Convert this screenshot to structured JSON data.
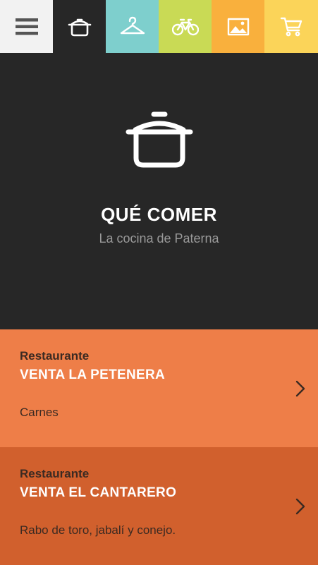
{
  "colors": {
    "menu_tab": "#f2f2f2",
    "food_tab": "#272727",
    "clothes_tab": "#7ecfcd",
    "bike_tab": "#c9da55",
    "gallery_tab": "#f9b03d",
    "cart_tab": "#fbd459",
    "hero_bg": "#272727",
    "card1_bg": "#ee7e48",
    "card2_bg": "#d1602d"
  },
  "topbar": {
    "tabs": [
      {
        "icon": "hamburger-menu-icon"
      },
      {
        "icon": "cooking-pot-icon",
        "active": true
      },
      {
        "icon": "clothes-hanger-icon"
      },
      {
        "icon": "bicycle-icon"
      },
      {
        "icon": "picture-icon"
      },
      {
        "icon": "shopping-cart-icon"
      }
    ]
  },
  "hero": {
    "icon": "cooking-pot-icon",
    "title": "QUÉ COMER",
    "subtitle": "La cocina de Paterna"
  },
  "listings": [
    {
      "type": "Restaurante",
      "name": "VENTA LA PETENERA",
      "description": "Carnes",
      "icon": "chevron-right-icon"
    },
    {
      "type": "Restaurante",
      "name": "VENTA EL CANTARERO",
      "description": "Rabo de toro, jabalí y conejo.",
      "icon": "chevron-right-icon"
    }
  ]
}
